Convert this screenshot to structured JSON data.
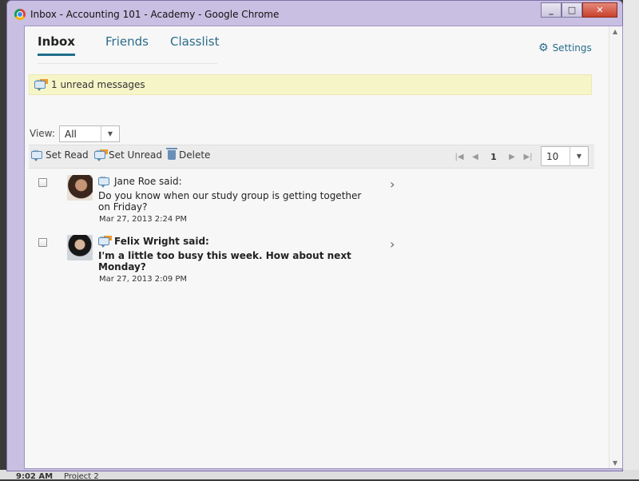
{
  "window": {
    "title": "Inbox - Accounting 101 -  Academy - Google Chrome",
    "minimize_glyph": "_",
    "maximize_glyph": "□",
    "close_glyph": "✕"
  },
  "tabs": [
    {
      "label": "Inbox",
      "active": true
    },
    {
      "label": "Friends",
      "active": false
    },
    {
      "label": "Classlist",
      "active": false
    }
  ],
  "settings": {
    "label": "Settings",
    "icon": "gear-icon"
  },
  "notice": {
    "text": "1 unread messages",
    "icon": "message-unread-icon"
  },
  "view": {
    "label": "View:",
    "selected": "All"
  },
  "toolbar": {
    "set_read": "Set Read",
    "set_unread": "Set Unread",
    "delete": "Delete"
  },
  "pager": {
    "current_page": "1",
    "page_size": "10"
  },
  "messages": [
    {
      "sender": "Jane Roe said:",
      "body": "Do you know when our study group is getting together on Friday?",
      "date": "Mar 27, 2013 2:24 PM",
      "unread": false
    },
    {
      "sender": "Felix Wright said:",
      "body": "I'm a little too busy this week. How about next Monday?",
      "date": "Mar 27, 2013 2:09 PM",
      "unread": true
    }
  ],
  "taskbar": {
    "time": "9:02 AM",
    "item": "Project 2"
  },
  "colors": {
    "accent": "#1f6e8c",
    "link": "#2a6c8a",
    "notice_bg": "#f6f5c8",
    "window_frame": "#c8bfe2"
  }
}
